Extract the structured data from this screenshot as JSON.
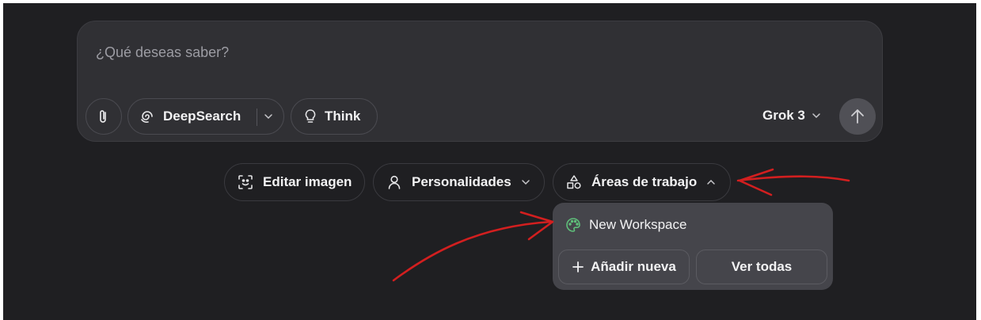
{
  "composer": {
    "placeholder": "¿Qué deseas saber?",
    "deepsearch_label": "DeepSearch",
    "think_label": "Think",
    "model_label": "Grok 3"
  },
  "chips": {
    "edit_image": "Editar imagen",
    "personalities": "Personalidades",
    "workspaces": "Áreas de trabajo"
  },
  "workspaces_menu": {
    "item": "New Workspace",
    "add_new": "Añadir nueva",
    "view_all": "Ver todas"
  },
  "colors": {
    "background": "#1f1f22",
    "composer": "#303034",
    "dropdown": "#45454b",
    "workspace_icon": "#5fbf7a",
    "annotation_arrow": "#d21f1f"
  },
  "icons": [
    "paperclip-icon",
    "deepsearch-swirl-icon",
    "chevron-down-icon",
    "lightbulb-icon",
    "arrow-up-icon",
    "image-edit-icon",
    "person-icon",
    "shapes-icon",
    "chevron-up-icon",
    "palette-icon",
    "plus-icon"
  ]
}
